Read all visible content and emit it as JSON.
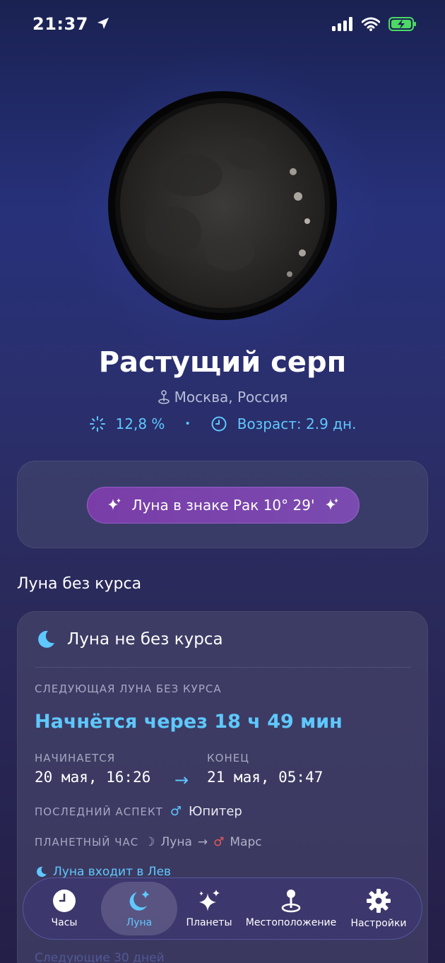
{
  "status": {
    "time": "21:37"
  },
  "phase": {
    "name": "Растущий серп",
    "location": "Москва, Россия",
    "illumination": "12,8 %",
    "age": "Возраст: 2.9 дн."
  },
  "sign": {
    "label": "Луна в знаке Рак 10° 29'"
  },
  "voc": {
    "section_title": "Луна без курса",
    "status": "Луна не без курса",
    "next_caption": "СЛЕДУЮЩАЯ ЛУНА БЕЗ КУРСА",
    "countdown": "Начнётся через 18 ч 49 мин",
    "start_caption": "НАЧИНАЕТСЯ",
    "start_value": "20 мая, 16:26",
    "end_caption": "КОНЕЦ",
    "end_value": "21 мая, 05:47",
    "last_aspect_caption": "ПОСЛЕДНИЙ АСПЕКТ",
    "last_aspect_value": "Юпитер",
    "planet_hour_caption": "ПЛАНЕТНЫЙ ЧАС",
    "planet_hour_from": "Луна",
    "planet_hour_to": "Марс",
    "enters": "Луна входит в Лев",
    "next30": "Следующие 30 дней"
  },
  "tabs": [
    {
      "label": "Часы",
      "icon": "clock-icon"
    },
    {
      "label": "Луна",
      "icon": "moon-stars-icon",
      "active": true
    },
    {
      "label": "Планеты",
      "icon": "sparkles-icon"
    },
    {
      "label": "Местоположение",
      "icon": "location-pin-icon"
    },
    {
      "label": "Настройки",
      "icon": "gear-icon"
    }
  ],
  "colors": {
    "accent": "#5ec8ff",
    "pill": "#7a3da8",
    "mars": "#e05a5a"
  }
}
